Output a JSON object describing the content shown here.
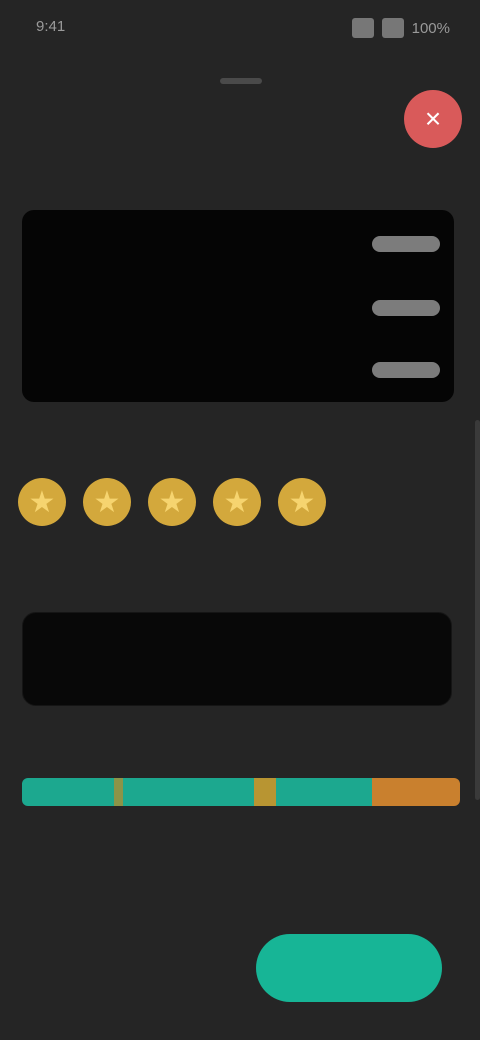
{
  "status_bar": {
    "time": "9:41",
    "battery": "100%"
  },
  "sheet": {
    "title": "",
    "close_icon": "close-icon"
  },
  "details": {
    "section_label": "",
    "rows": [
      {
        "label": "",
        "value": ""
      },
      {
        "label": "",
        "value": ""
      },
      {
        "label": "",
        "value": ""
      }
    ]
  },
  "rating": {
    "section_label": "",
    "value": 5,
    "max": 5
  },
  "feedback": {
    "section_label": "",
    "placeholder": ""
  },
  "breakdown": {
    "section_label": "",
    "segments": [
      {
        "fraction": 0.21,
        "color": "#1ca88f"
      },
      {
        "fraction": 0.02,
        "color": "#8b9448"
      },
      {
        "fraction": 0.3,
        "color": "#1ca88f"
      },
      {
        "fraction": 0.05,
        "color": "#b89532"
      },
      {
        "fraction": 0.22,
        "color": "#1ca88f"
      },
      {
        "fraction": 0.2,
        "color": "#c9802e"
      }
    ],
    "left_top": "",
    "left_bottom": "",
    "right_bottom": ""
  },
  "actions": {
    "skip_label": "",
    "submit_label": ""
  },
  "colors": {
    "accent": "#17b596",
    "title": "#c9872e",
    "close": "#d95a5a",
    "star": "#d3a83c"
  }
}
